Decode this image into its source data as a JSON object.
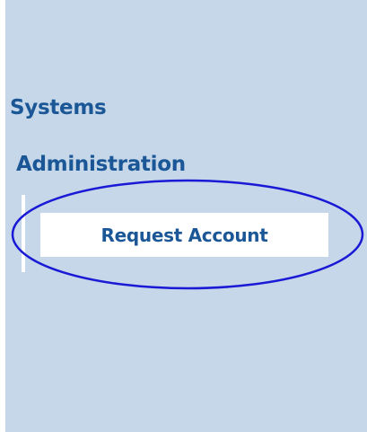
{
  "nav": {
    "headings": {
      "systems": "Systems",
      "administration": "Administration"
    },
    "submenu": {
      "request_account": "Request Account"
    }
  },
  "colors": {
    "panel_background": "#c5d7e8",
    "link_text": "#1b5796",
    "highlight_ellipse": "#1a1ad6"
  }
}
